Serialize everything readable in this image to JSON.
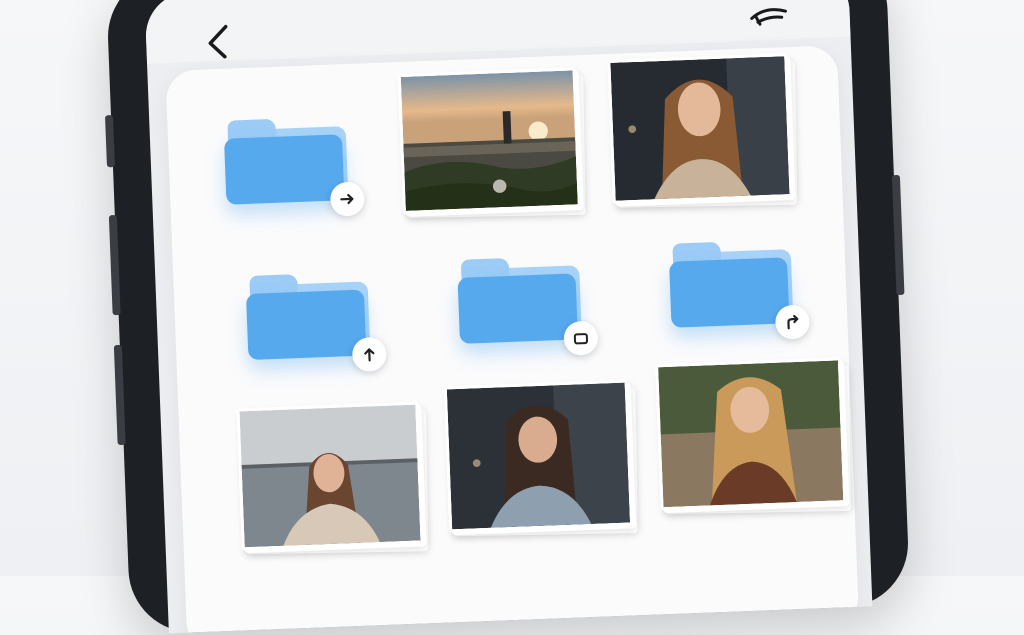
{
  "screen": {
    "title": "",
    "icons": {
      "back": "back-arrow-icon",
      "menu": "menu-icon"
    }
  },
  "grid": {
    "items": [
      {
        "kind": "folder",
        "badge_icon": "arrow-right-icon"
      },
      {
        "kind": "photo",
        "scene": "city-skyline-sunset"
      },
      {
        "kind": "photo",
        "scene": "woman-portrait-dark"
      },
      {
        "kind": "folder",
        "badge_icon": "upload-arrow-icon"
      },
      {
        "kind": "folder",
        "badge_icon": "rounded-square-icon"
      },
      {
        "kind": "folder",
        "badge_icon": "share-arrow-icon"
      },
      {
        "kind": "photo",
        "scene": "woman-by-lake"
      },
      {
        "kind": "photo",
        "scene": "woman-in-denim-jacket"
      },
      {
        "kind": "photo",
        "scene": "woman-in-field"
      }
    ]
  },
  "colors": {
    "folder_front": "#57a9ee",
    "folder_back": "#a9d3f8",
    "sheet": "#fbfbfc",
    "phone_frame": "#1d2024"
  }
}
